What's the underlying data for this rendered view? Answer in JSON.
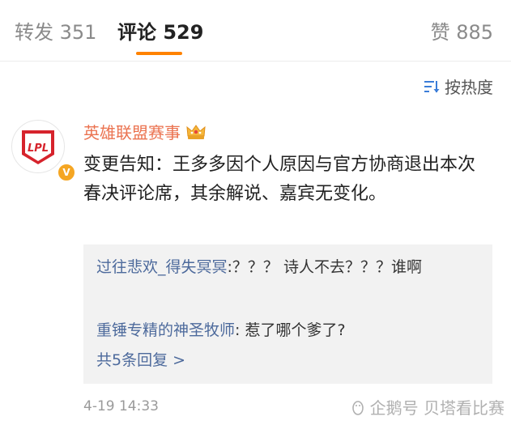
{
  "tabs": {
    "reposts": "转发 351",
    "comments": "评论 529",
    "likes": "赞 885"
  },
  "sort": {
    "label": "按热度",
    "icon": "sort-icon"
  },
  "comment": {
    "author": "英雄联盟赛事",
    "avatar_logo_text": "LPL",
    "author_badge_icon": "crown-icon",
    "verified_badge": "V",
    "text": "变更告知：王多多因个人原因与官方协商退出本次春决评论席，其余解说、嘉宾无变化。",
    "timestamp": "4-19 14:33"
  },
  "replies": [
    {
      "user": "过往悲欢_得失冥冥",
      "text": ":？？？ 诗人不去？？？谁啊"
    },
    {
      "user": "重锤专精的神圣牧师",
      "text": ": 惹了哪个爹了?"
    }
  ],
  "more_replies": "共5条回复 >",
  "watermark": "企鹅号 贝塔看比赛",
  "colors": {
    "accent": "#ff8200",
    "author": "#eb7350",
    "link": "#4d6a9c",
    "avatar_red": "#d6232c"
  }
}
